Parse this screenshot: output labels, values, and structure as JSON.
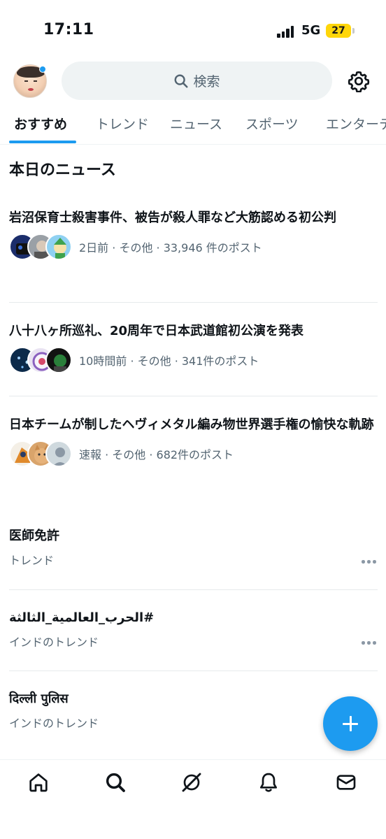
{
  "status_bar": {
    "time": "17:11",
    "network": "5G",
    "battery": "27"
  },
  "search": {
    "placeholder": "検索"
  },
  "tabs": [
    {
      "label": "おすすめ",
      "active": true
    },
    {
      "label": "トレンド"
    },
    {
      "label": "ニュース"
    },
    {
      "label": "スポーツ"
    },
    {
      "label": "エンターテ"
    }
  ],
  "section_title": "本日のニュース",
  "news": [
    {
      "headline": "岩沼保育士殺害事件、被告が殺人罪など大筋認める初公判",
      "meta": "2日前 · その他 · 33,946 件のポスト"
    },
    {
      "headline": "八十八ヶ所巡礼、20周年で日本武道館初公演を発表",
      "meta": "10時間前 · その他 · 341件のポスト"
    },
    {
      "headline": "日本チームが制したヘヴィメタル編み物世界選手権の愉快な軌跡",
      "meta": "速報 · その他 · 682件のポスト"
    }
  ],
  "trends": [
    {
      "title": "医師免許",
      "subtitle": "トレンド"
    },
    {
      "title": "#الحرب_العالمية_الثالثة",
      "subtitle": "インドのトレンド"
    },
    {
      "title": "दिल्ली पुलिस",
      "subtitle": "インドのトレンド"
    }
  ],
  "colors": {
    "accent": "#1d9bf0",
    "text": "#0f1419",
    "muted": "#536471",
    "battery": "#ffd60a"
  },
  "icons": {
    "bottom_nav": [
      "home-icon",
      "search-icon",
      "grok-icon",
      "bell-icon",
      "mail-icon"
    ],
    "top": [
      "search-icon",
      "gear-icon"
    ],
    "fab": "plus-icon"
  }
}
